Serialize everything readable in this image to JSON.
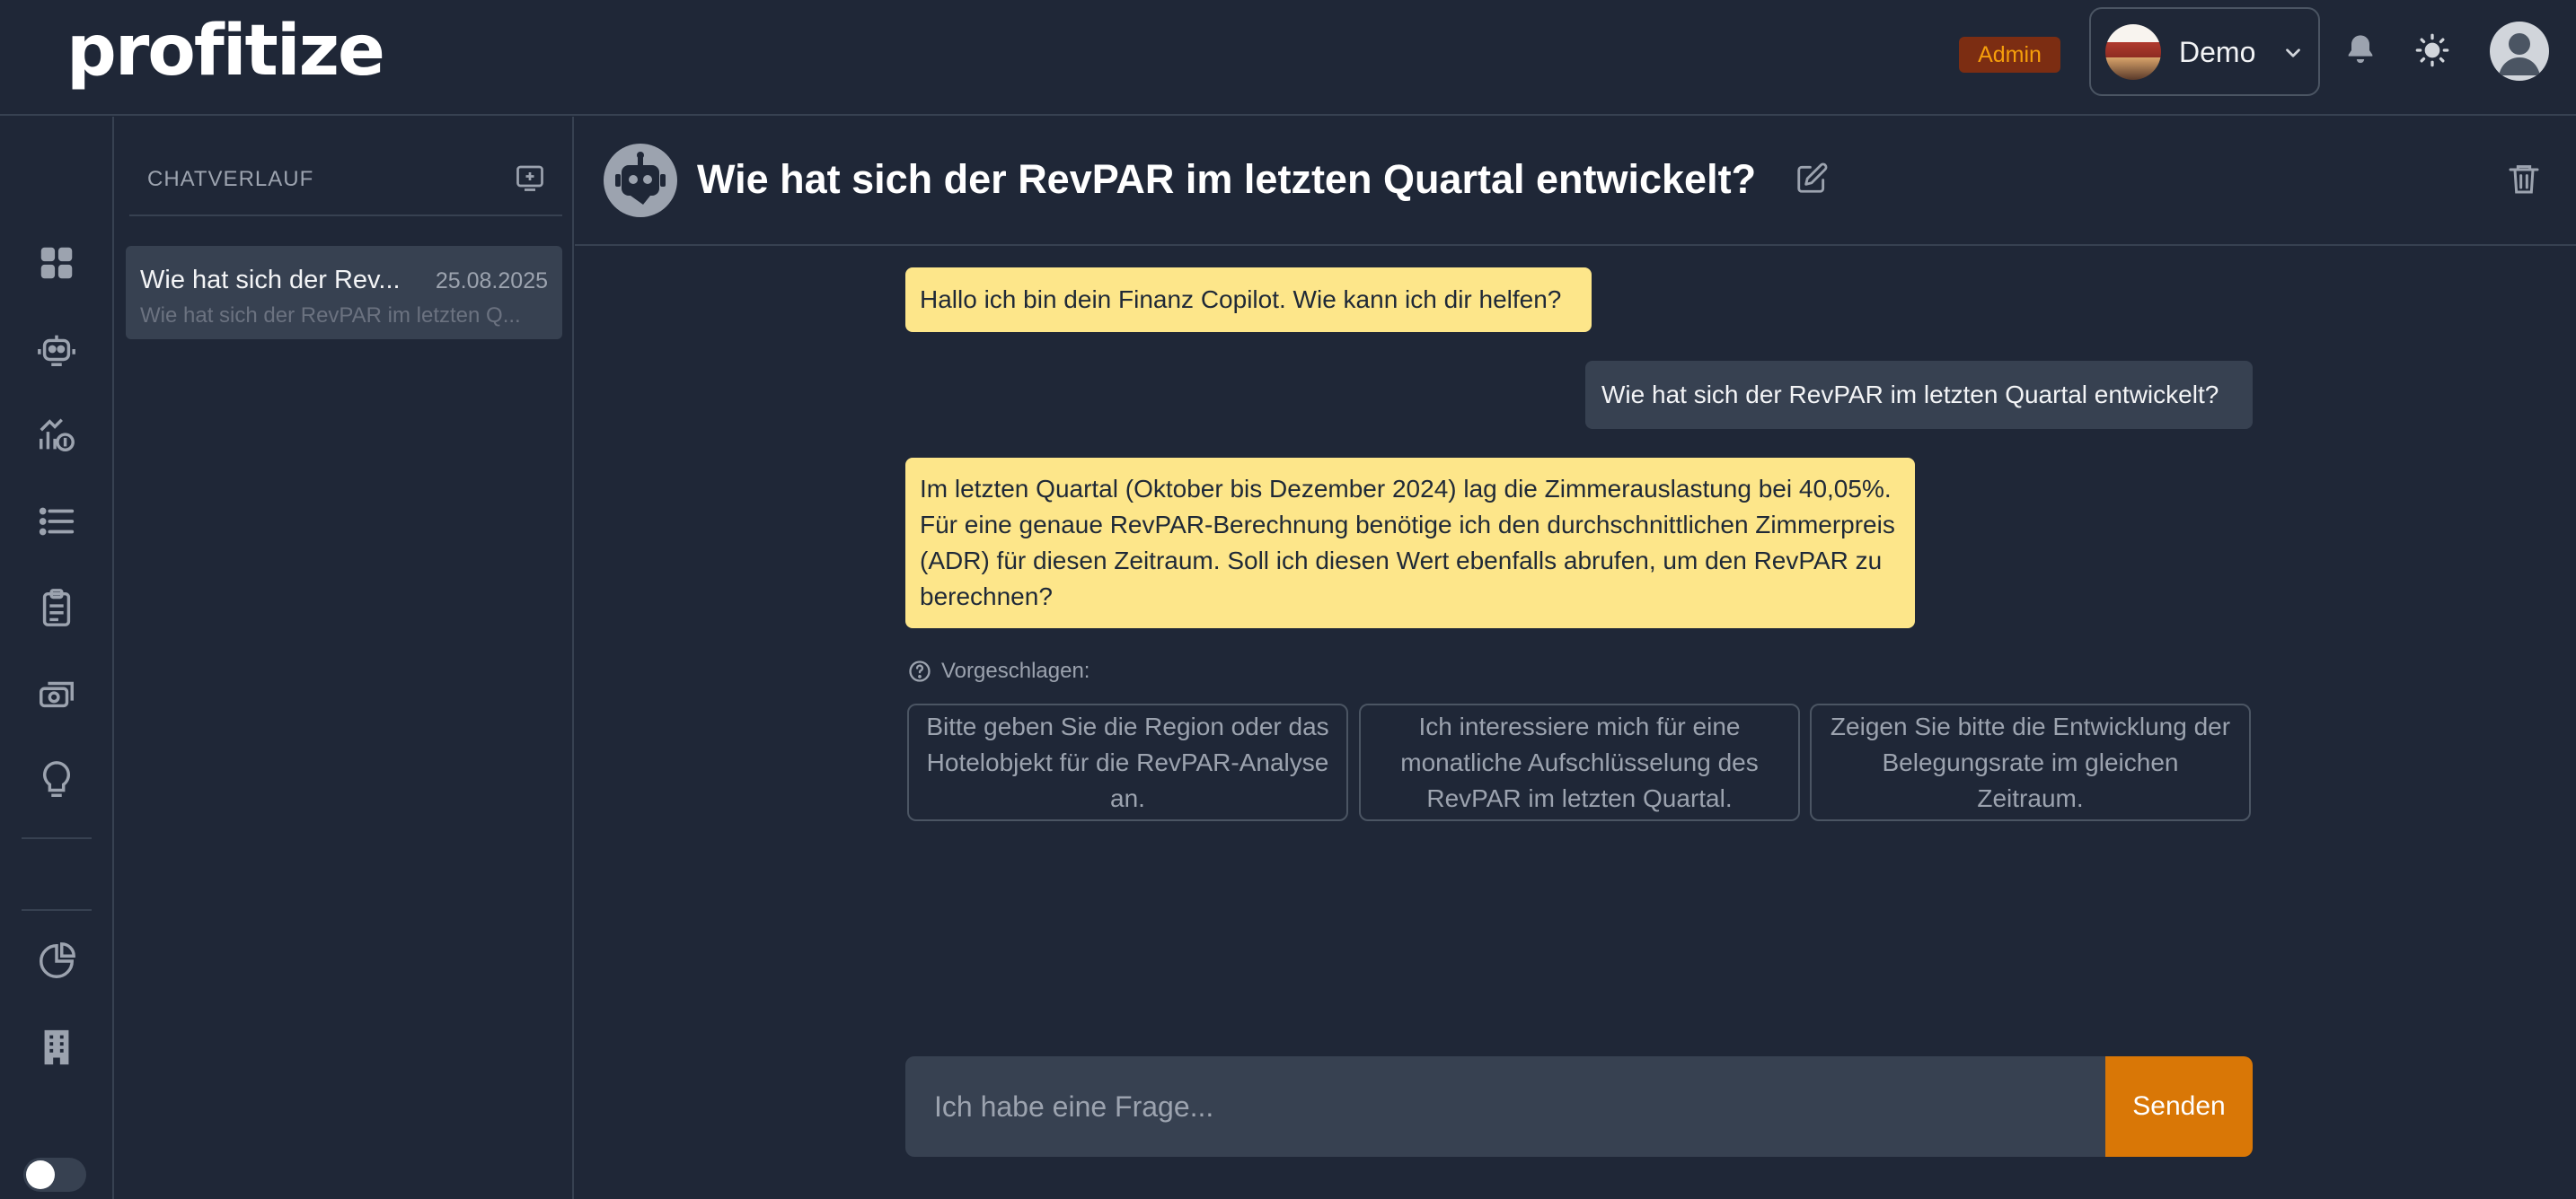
{
  "header": {
    "logo": "profitize",
    "admin_badge": "Admin",
    "workspace": {
      "label": "Demo"
    },
    "icons": [
      "bell-icon",
      "sun-icon",
      "user-avatar"
    ]
  },
  "rail": {
    "items": [
      {
        "icon": "dashboard-grid-icon"
      },
      {
        "icon": "robot-icon"
      },
      {
        "icon": "chart-money-icon"
      },
      {
        "icon": "list-icon"
      },
      {
        "icon": "clipboard-icon"
      },
      {
        "icon": "cash-icon"
      },
      {
        "icon": "lightbulb-icon"
      },
      {
        "icon": "pie-chart-icon"
      },
      {
        "icon": "building-icon"
      }
    ]
  },
  "history": {
    "title": "CHATVERLAUF",
    "items": [
      {
        "title": "Wie hat sich der Rev...",
        "date": "25.08.2025",
        "preview": "Wie hat sich der RevPAR im letzten Q..."
      }
    ]
  },
  "chat": {
    "title": "Wie hat sich der RevPAR im letzten Quartal entwickelt?",
    "messages": [
      {
        "role": "bot",
        "text": "Hallo ich bin dein Finanz Copilot. Wie kann ich dir helfen?"
      },
      {
        "role": "user",
        "text": "Wie hat sich der RevPAR im letzten Quartal entwickelt?"
      },
      {
        "role": "bot",
        "text": "Im letzten Quartal (Oktober bis Dezember 2024) lag die Zimmerauslastung bei 40,05%. Für eine genaue RevPAR-Berechnung benötige ich den durchschnittlichen Zimmerpreis (ADR) für diesen Zeitraum. Soll ich diesen Wert ebenfalls abrufen, um den RevPAR zu berechnen?"
      }
    ],
    "suggested_label": "Vorgeschlagen:",
    "suggestions": [
      "Bitte geben Sie die Region oder das Hotelobjekt für die RevPAR-Analyse an.",
      "Ich interessiere mich für eine monatliche Aufschlüsselung des RevPAR im letzten Quartal.",
      "Zeigen Sie bitte die Entwicklung der Belegungsrate im gleichen Zeitraum."
    ],
    "composer": {
      "placeholder": "Ich habe eine Frage...",
      "value": "",
      "send_label": "Senden"
    }
  },
  "colors": {
    "background": "#1f2737",
    "bot_bubble": "#fde68a",
    "user_bubble": "#374151",
    "accent": "#d97706",
    "admin_badge_bg": "#7c2d12",
    "admin_badge_fg": "#f59e0b"
  }
}
